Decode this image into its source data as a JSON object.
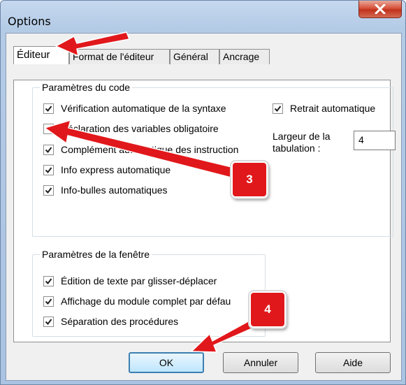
{
  "window": {
    "title": "Options"
  },
  "tabs": [
    {
      "label": "Éditeur",
      "active": true
    },
    {
      "label": "Format de l'éditeur",
      "active": false
    },
    {
      "label": "Général",
      "active": false
    },
    {
      "label": "Ancrage",
      "active": false
    }
  ],
  "code_settings": {
    "legend": "Paramètres du code",
    "options": [
      {
        "label": "Vérification automatique de la syntaxe",
        "checked": true
      },
      {
        "label": "Déclaration des variables obligatoire",
        "checked": false
      },
      {
        "label": "Complément automatique des instruction",
        "checked": true
      },
      {
        "label": "Info express automatique",
        "checked": true
      },
      {
        "label": "Info-bulles automatiques",
        "checked": true
      }
    ],
    "auto_indent": {
      "label": "Retrait automatique",
      "checked": true
    },
    "tab_width": {
      "label_line1": "Largeur de la",
      "label_line2": "tabulation :",
      "value": "4"
    }
  },
  "window_settings": {
    "legend": "Paramètres de la fenêtre",
    "options": [
      {
        "label": "Édition de texte par glisser-déplacer",
        "checked": true
      },
      {
        "label": "Affichage du module complet par défau",
        "checked": true
      },
      {
        "label": "Séparation des procédures",
        "checked": true
      }
    ]
  },
  "buttons": {
    "ok": "OK",
    "cancel": "Annuler",
    "help": "Aide"
  },
  "annotations": {
    "callout_3": "3",
    "callout_4": "4"
  },
  "colors": {
    "annotation_red": "#e1181b",
    "default_button_border": "#3c7fb1",
    "title_bar": "#b4cbe6"
  }
}
